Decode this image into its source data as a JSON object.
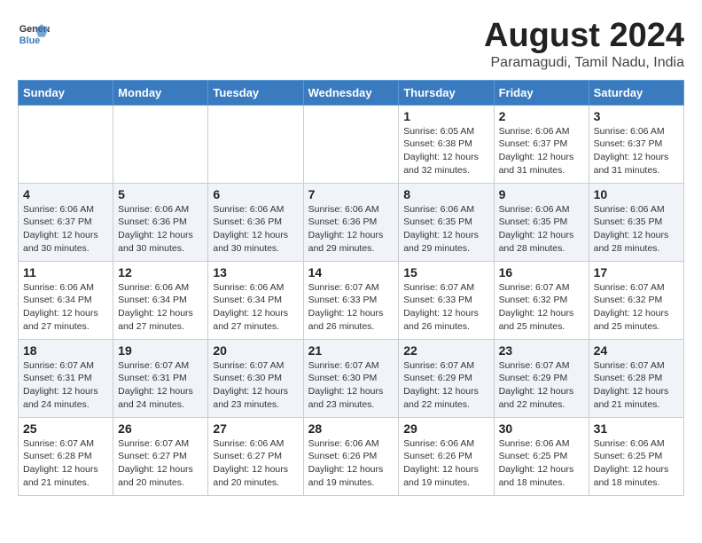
{
  "header": {
    "logo_line1": "General",
    "logo_line2": "Blue",
    "month_year": "August 2024",
    "location": "Paramagudi, Tamil Nadu, India"
  },
  "weekdays": [
    "Sunday",
    "Monday",
    "Tuesday",
    "Wednesday",
    "Thursday",
    "Friday",
    "Saturday"
  ],
  "weeks": [
    [
      {
        "day": "",
        "info": ""
      },
      {
        "day": "",
        "info": ""
      },
      {
        "day": "",
        "info": ""
      },
      {
        "day": "",
        "info": ""
      },
      {
        "day": "1",
        "info": "Sunrise: 6:05 AM\nSunset: 6:38 PM\nDaylight: 12 hours\nand 32 minutes."
      },
      {
        "day": "2",
        "info": "Sunrise: 6:06 AM\nSunset: 6:37 PM\nDaylight: 12 hours\nand 31 minutes."
      },
      {
        "day": "3",
        "info": "Sunrise: 6:06 AM\nSunset: 6:37 PM\nDaylight: 12 hours\nand 31 minutes."
      }
    ],
    [
      {
        "day": "4",
        "info": "Sunrise: 6:06 AM\nSunset: 6:37 PM\nDaylight: 12 hours\nand 30 minutes."
      },
      {
        "day": "5",
        "info": "Sunrise: 6:06 AM\nSunset: 6:36 PM\nDaylight: 12 hours\nand 30 minutes."
      },
      {
        "day": "6",
        "info": "Sunrise: 6:06 AM\nSunset: 6:36 PM\nDaylight: 12 hours\nand 30 minutes."
      },
      {
        "day": "7",
        "info": "Sunrise: 6:06 AM\nSunset: 6:36 PM\nDaylight: 12 hours\nand 29 minutes."
      },
      {
        "day": "8",
        "info": "Sunrise: 6:06 AM\nSunset: 6:35 PM\nDaylight: 12 hours\nand 29 minutes."
      },
      {
        "day": "9",
        "info": "Sunrise: 6:06 AM\nSunset: 6:35 PM\nDaylight: 12 hours\nand 28 minutes."
      },
      {
        "day": "10",
        "info": "Sunrise: 6:06 AM\nSunset: 6:35 PM\nDaylight: 12 hours\nand 28 minutes."
      }
    ],
    [
      {
        "day": "11",
        "info": "Sunrise: 6:06 AM\nSunset: 6:34 PM\nDaylight: 12 hours\nand 27 minutes."
      },
      {
        "day": "12",
        "info": "Sunrise: 6:06 AM\nSunset: 6:34 PM\nDaylight: 12 hours\nand 27 minutes."
      },
      {
        "day": "13",
        "info": "Sunrise: 6:06 AM\nSunset: 6:34 PM\nDaylight: 12 hours\nand 27 minutes."
      },
      {
        "day": "14",
        "info": "Sunrise: 6:07 AM\nSunset: 6:33 PM\nDaylight: 12 hours\nand 26 minutes."
      },
      {
        "day": "15",
        "info": "Sunrise: 6:07 AM\nSunset: 6:33 PM\nDaylight: 12 hours\nand 26 minutes."
      },
      {
        "day": "16",
        "info": "Sunrise: 6:07 AM\nSunset: 6:32 PM\nDaylight: 12 hours\nand 25 minutes."
      },
      {
        "day": "17",
        "info": "Sunrise: 6:07 AM\nSunset: 6:32 PM\nDaylight: 12 hours\nand 25 minutes."
      }
    ],
    [
      {
        "day": "18",
        "info": "Sunrise: 6:07 AM\nSunset: 6:31 PM\nDaylight: 12 hours\nand 24 minutes."
      },
      {
        "day": "19",
        "info": "Sunrise: 6:07 AM\nSunset: 6:31 PM\nDaylight: 12 hours\nand 24 minutes."
      },
      {
        "day": "20",
        "info": "Sunrise: 6:07 AM\nSunset: 6:30 PM\nDaylight: 12 hours\nand 23 minutes."
      },
      {
        "day": "21",
        "info": "Sunrise: 6:07 AM\nSunset: 6:30 PM\nDaylight: 12 hours\nand 23 minutes."
      },
      {
        "day": "22",
        "info": "Sunrise: 6:07 AM\nSunset: 6:29 PM\nDaylight: 12 hours\nand 22 minutes."
      },
      {
        "day": "23",
        "info": "Sunrise: 6:07 AM\nSunset: 6:29 PM\nDaylight: 12 hours\nand 22 minutes."
      },
      {
        "day": "24",
        "info": "Sunrise: 6:07 AM\nSunset: 6:28 PM\nDaylight: 12 hours\nand 21 minutes."
      }
    ],
    [
      {
        "day": "25",
        "info": "Sunrise: 6:07 AM\nSunset: 6:28 PM\nDaylight: 12 hours\nand 21 minutes."
      },
      {
        "day": "26",
        "info": "Sunrise: 6:07 AM\nSunset: 6:27 PM\nDaylight: 12 hours\nand 20 minutes."
      },
      {
        "day": "27",
        "info": "Sunrise: 6:06 AM\nSunset: 6:27 PM\nDaylight: 12 hours\nand 20 minutes."
      },
      {
        "day": "28",
        "info": "Sunrise: 6:06 AM\nSunset: 6:26 PM\nDaylight: 12 hours\nand 19 minutes."
      },
      {
        "day": "29",
        "info": "Sunrise: 6:06 AM\nSunset: 6:26 PM\nDaylight: 12 hours\nand 19 minutes."
      },
      {
        "day": "30",
        "info": "Sunrise: 6:06 AM\nSunset: 6:25 PM\nDaylight: 12 hours\nand 18 minutes."
      },
      {
        "day": "31",
        "info": "Sunrise: 6:06 AM\nSunset: 6:25 PM\nDaylight: 12 hours\nand 18 minutes."
      }
    ]
  ]
}
